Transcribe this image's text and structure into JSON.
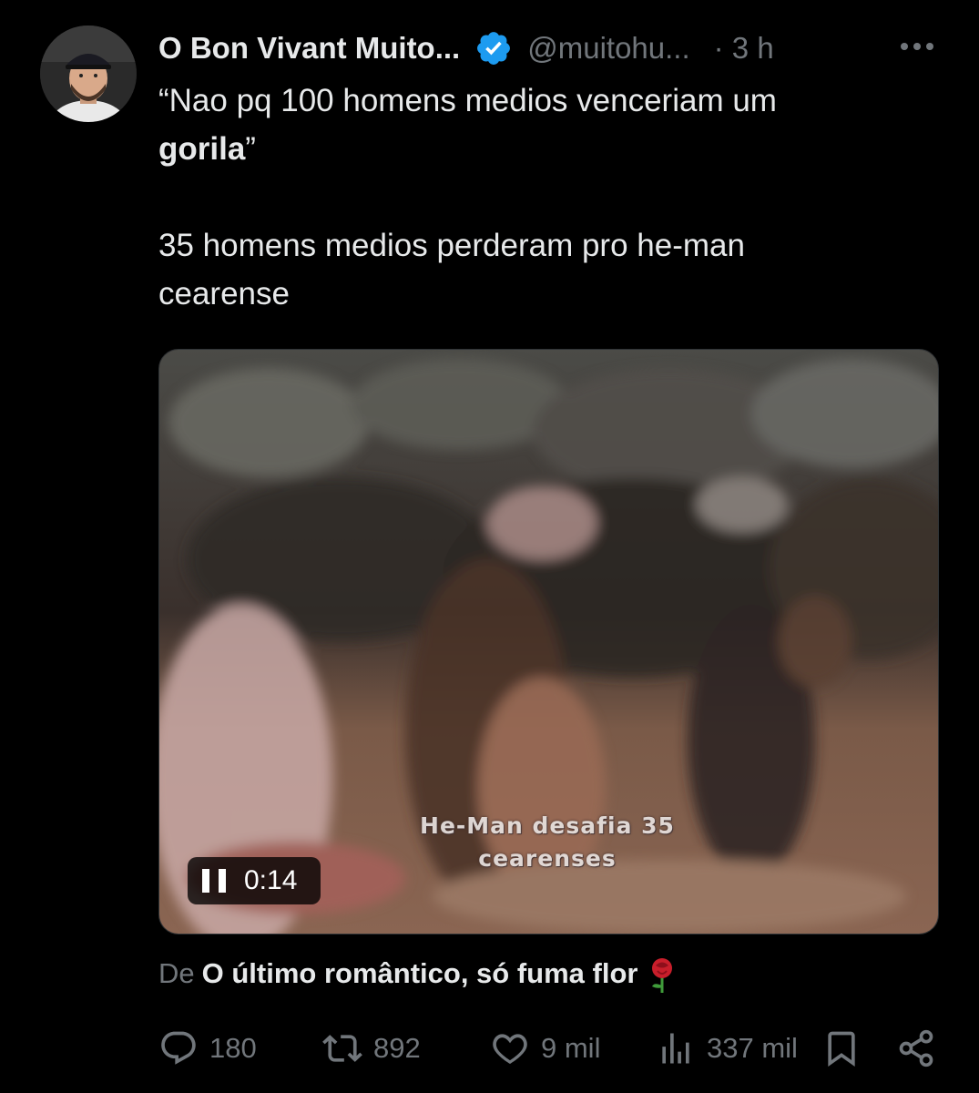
{
  "tweet": {
    "author_name": "O Bon Vivant Muito...",
    "handle": "@muitohu...",
    "time": "· 3 h",
    "text_line1": "“Nao pq 100 homens medios venceriam um",
    "text_bold": "gorila",
    "text_after_bold": "”",
    "text_line3": "35 homens medios perderam pro he-man",
    "text_line4": "cearense",
    "verified_color": "#1d9bf0"
  },
  "media": {
    "caption_line1": "He-Man desafia 35",
    "caption_line2": "cearenses",
    "player_state": "pause-icon",
    "player_time": "0:14"
  },
  "attribution": {
    "prefix": "De",
    "community_name": "O último romântico, só fuma flor",
    "emoji": "rose-icon"
  },
  "actions": {
    "replies": "180",
    "reposts": "892",
    "likes": "9 mil",
    "views": "337 mil"
  }
}
